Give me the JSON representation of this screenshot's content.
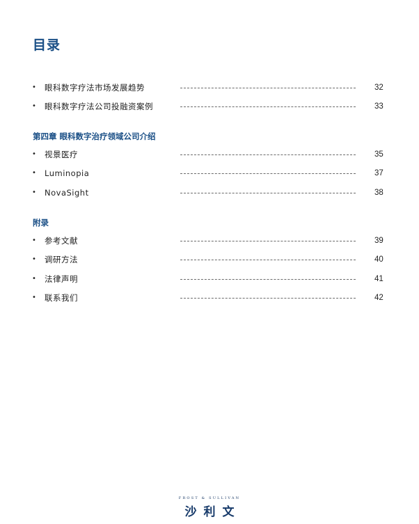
{
  "page_title": "目录",
  "sections": [
    {
      "heading": null,
      "items": [
        {
          "label": "眼科数字疗法市场发展趋势",
          "page": "32"
        },
        {
          "label": "眼科数字疗法公司投融资案例",
          "page": "33"
        }
      ]
    },
    {
      "heading": "第四章 眼科数字治疗领域公司介绍",
      "items": [
        {
          "label": "视景医疗",
          "page": "35"
        },
        {
          "label": "Luminopia",
          "page": "37"
        },
        {
          "label": "NovaSight",
          "page": "38"
        }
      ]
    },
    {
      "heading": "附录",
      "items": [
        {
          "label": "参考文献",
          "page": "39"
        },
        {
          "label": "调研方法",
          "page": "40"
        },
        {
          "label": "法律声明",
          "page": "41"
        },
        {
          "label": "联系我们",
          "page": "42"
        }
      ]
    }
  ],
  "bullet": "•",
  "footer": {
    "logo_en": "FROST & SULLIVAN",
    "logo_cn": "沙利文"
  },
  "colors": {
    "heading": "#1a4f86",
    "text": "#222222"
  }
}
